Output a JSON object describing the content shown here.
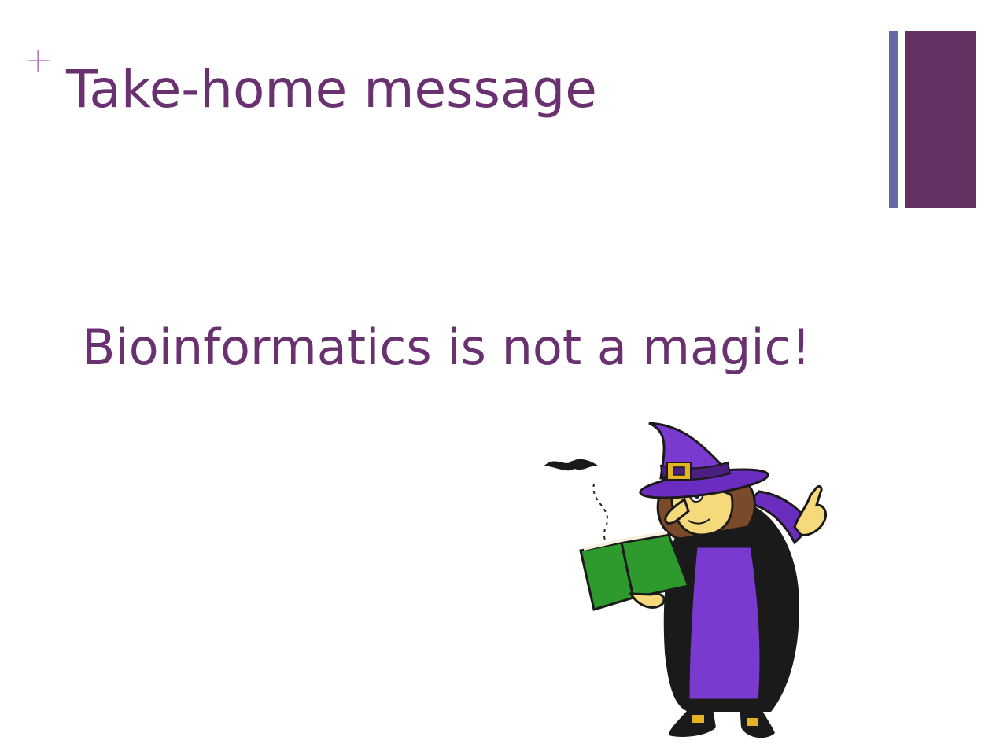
{
  "slide": {
    "bullet_symbol": "+",
    "title": "Take-home message",
    "body": "Bioinformatics is not a magic!",
    "colors": {
      "title_text": "#6a3170",
      "bullet": "#b57fc4",
      "accent_bar_thin": "#6668a6",
      "accent_bar_thick": "#633263"
    },
    "illustration": "witch-reading-spellbook-icon"
  }
}
